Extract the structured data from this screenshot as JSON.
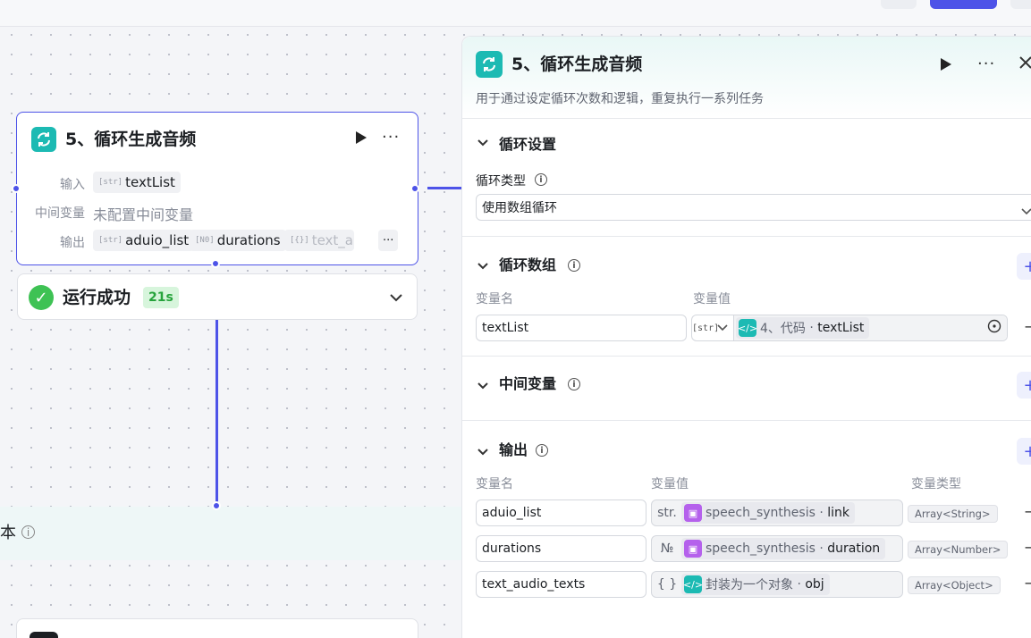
{
  "colors": {
    "accent": "#4d53e8",
    "loop_icon": "#1cbab3",
    "success": "#3ec254",
    "plugin_icon": "#b561ec"
  },
  "node": {
    "title": "5、循环生成音频",
    "input_label": "输入",
    "input_var": "textList",
    "intermediate_label": "中间变量",
    "intermediate_value": "未配置中间变量",
    "output_label": "输出",
    "outputs": [
      "aduio_list",
      "durations",
      "text_au"
    ],
    "more_label": "···"
  },
  "status": {
    "text": "运行成功",
    "time": "21s"
  },
  "group": {
    "label": "本"
  },
  "panel": {
    "title": "5、循环生成音频",
    "description": "用于通过设定循环次数和逻辑，重复执行一系列任务",
    "loop_settings": {
      "title": "循环设置",
      "type_label": "循环类型",
      "type_value": "使用数组循环"
    },
    "loop_array": {
      "title": "循环数组",
      "col_name": "变量名",
      "col_value": "变量值",
      "row": {
        "name": "textList",
        "type_tag": "str",
        "ref_node": "4、代码",
        "ref_var": "textList"
      }
    },
    "intermediate": {
      "title": "中间变量"
    },
    "output": {
      "title": "输出",
      "col_name": "变量名",
      "col_value": "变量值",
      "col_type": "变量类型",
      "rows": [
        {
          "name": "aduio_list",
          "tag": "str.",
          "ref_node": "speech_synthesis",
          "ref_var": "link",
          "type": "Array<String>"
        },
        {
          "name": "durations",
          "tag": "№",
          "ref_node": "speech_synthesis",
          "ref_var": "duration",
          "type": "Array<Number>"
        },
        {
          "name": "text_audio_texts",
          "tag": "{ }",
          "ref_node": "封装为一个对象",
          "ref_var": "obj",
          "type": "Array<Object>"
        }
      ]
    }
  }
}
